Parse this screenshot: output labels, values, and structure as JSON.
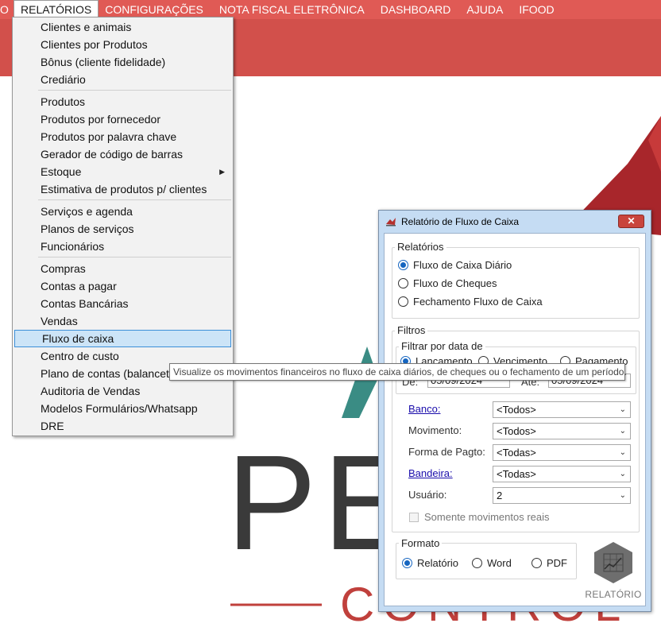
{
  "menubar": {
    "items": [
      {
        "label": "O"
      },
      {
        "label": "RELATÓRIOS"
      },
      {
        "label": "CONFIGURAÇÕES"
      },
      {
        "label": "NOTA FISCAL ELETRÔNICA"
      },
      {
        "label": "DASHBOARD"
      },
      {
        "label": "AJUDA"
      },
      {
        "label": "IFOOD"
      }
    ]
  },
  "background": {
    "logo_text": "PET",
    "logo_sub": "CONTROL",
    "colors": {
      "brand_red": "#d2504b",
      "teal": "#3a8c84",
      "dark_text": "#3a3a3a"
    }
  },
  "dropdown": {
    "items": [
      {
        "label": "Clientes e animais"
      },
      {
        "label": "Clientes por Produtos"
      },
      {
        "label": "Bônus (cliente fidelidade)"
      },
      {
        "label": "Crediário"
      },
      {
        "label": "Produtos"
      },
      {
        "label": "Produtos por fornecedor"
      },
      {
        "label": "Produtos por palavra chave"
      },
      {
        "label": "Gerador de código de barras"
      },
      {
        "label": "Estoque"
      },
      {
        "label": "Estimativa de produtos p/ clientes"
      },
      {
        "label": "Serviços e agenda"
      },
      {
        "label": "Planos de serviços"
      },
      {
        "label": "Funcionários"
      },
      {
        "label": "Compras"
      },
      {
        "label": "Contas a pagar"
      },
      {
        "label": "Contas Bancárias"
      },
      {
        "label": "Vendas"
      },
      {
        "label": "Fluxo de caixa"
      },
      {
        "label": "Centro de custo"
      },
      {
        "label": "Plano de contas (balancete)"
      },
      {
        "label": "Auditoria de Vendas"
      },
      {
        "label": "Modelos Formulários/Whatsapp"
      },
      {
        "label": "DRE"
      }
    ]
  },
  "tooltip": {
    "text": "Visualize os movimentos financeiros no fluxo de caixa diários, de cheques ou o fechamento de um período."
  },
  "dialog": {
    "title": "Relatório de Fluxo de Caixa",
    "close_label": "✕",
    "relatorios": {
      "group_label": "Relatórios",
      "options": [
        "Fluxo de Caixa Diário",
        "Fluxo de Cheques",
        "Fechamento Fluxo de Caixa"
      ],
      "selected": "Fluxo de Caixa Diário"
    },
    "filtros": {
      "group_label": "Filtros",
      "data_group_label": "Filtrar por data de",
      "data_options": [
        "Lançamento",
        "Vencimento",
        "Pagamento"
      ],
      "data_selected": "Lançamento",
      "de_label": "De:",
      "de_value": "05/09/2024",
      "ate_label": "Até:",
      "ate_value": "05/09/2024",
      "banco_label": "Banco:",
      "banco_value": "<Todos>",
      "movimento_label": "Movimento:",
      "movimento_value": "<Todos>",
      "forma_label": "Forma de Pagto:",
      "forma_value": "<Todas>",
      "bandeira_label": "Bandeira:",
      "bandeira_value": "<Todas>",
      "usuario_label": "Usuário:",
      "usuario_value": "2",
      "somente_label": "Somente movimentos reais"
    },
    "formato": {
      "group_label": "Formato",
      "options": [
        "Relatório",
        "Word",
        "PDF"
      ],
      "selected": "Relatório"
    },
    "relatorio_button_label": "RELATÓRIO"
  }
}
